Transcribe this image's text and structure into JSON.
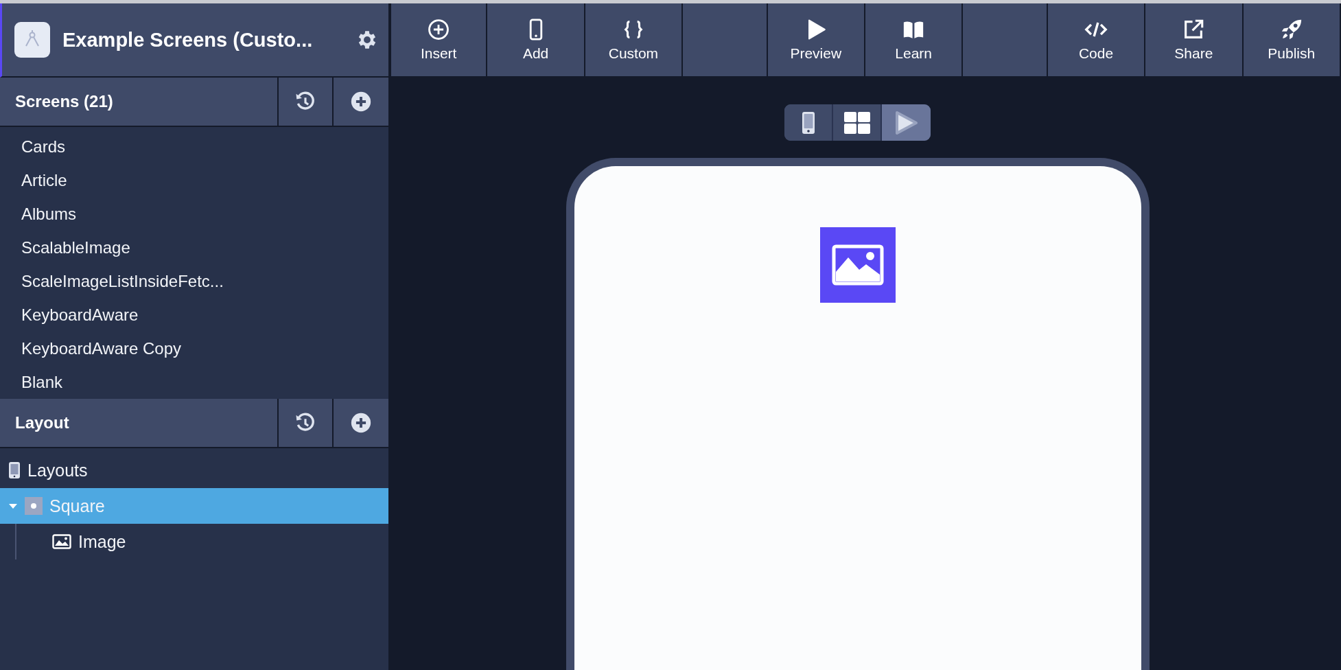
{
  "project": {
    "title": "Example Screens (Custo..."
  },
  "toolbar": {
    "groups": [
      [
        {
          "label": "Insert",
          "kind": "insert"
        },
        {
          "label": "Add",
          "kind": "add"
        },
        {
          "label": "Custom",
          "kind": "custom"
        }
      ],
      [
        {
          "label": "Preview",
          "kind": "preview"
        },
        {
          "label": "Learn",
          "kind": "learn"
        }
      ],
      [
        {
          "label": "Code",
          "kind": "code"
        },
        {
          "label": "Share",
          "kind": "share"
        },
        {
          "label": "Publish",
          "kind": "publish"
        }
      ]
    ]
  },
  "screens_panel": {
    "title": "Screens (21)",
    "items": [
      "Cards",
      "Article",
      "Albums",
      "ScalableImage",
      "ScaleImageListInsideFetc...",
      "KeyboardAware",
      "KeyboardAware Copy",
      "Blank"
    ]
  },
  "layout_panel": {
    "title": "Layout",
    "tree": [
      {
        "label": "Layouts",
        "kind": "device",
        "selected": false
      },
      {
        "label": "Square",
        "kind": "view",
        "selected": true,
        "expanded": true,
        "children": [
          {
            "label": "Image",
            "kind": "image",
            "selected": false
          }
        ]
      }
    ]
  },
  "view_modes": [
    {
      "kind": "phone",
      "selected": false
    },
    {
      "kind": "grid",
      "selected": false
    },
    {
      "kind": "play",
      "selected": true
    }
  ]
}
